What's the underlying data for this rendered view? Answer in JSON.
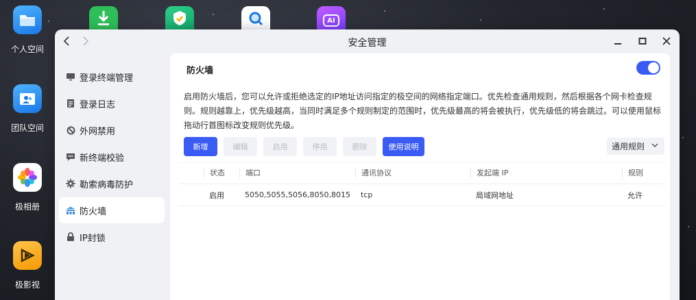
{
  "desktop": {
    "icons": [
      {
        "label": "个人空间",
        "name": "personal-space"
      },
      {
        "label": "团队空间",
        "name": "team-space"
      },
      {
        "label": "极相册",
        "name": "photo-album"
      },
      {
        "label": "极影视",
        "name": "video"
      }
    ],
    "top_apps": [
      {
        "name": "download-app-icon"
      },
      {
        "name": "security-app-icon"
      },
      {
        "name": "search-app-icon"
      },
      {
        "name": "ai-app-icon",
        "text": "AI"
      }
    ]
  },
  "window": {
    "title": "安全管理",
    "sidebar": {
      "items": [
        {
          "label": "登录终端管理",
          "icon": "monitor-icon"
        },
        {
          "label": "登录日志",
          "icon": "document-icon"
        },
        {
          "label": "外网禁用",
          "icon": "ban-icon"
        },
        {
          "label": "新终端校验",
          "icon": "message-icon"
        },
        {
          "label": "勒索病毒防护",
          "icon": "gear-icon"
        },
        {
          "label": "防火墙",
          "icon": "firewall-icon",
          "active": true
        },
        {
          "label": "IP封锁",
          "icon": "lock-icon"
        }
      ]
    },
    "firewall": {
      "title": "防火墙",
      "enabled": true,
      "description": "启用防火墙后，您可以允许或拒绝选定的IP地址访问指定的极空间的网络指定端口。优先检查通用规则，然后根据各个网卡检查规则。规则越靠上，优先级越高，当同时满足多个规则制定的范围时，优先级最高的将会被执行，优先级低的将会跳过。可以使用鼠标拖动行首图标改变规则优先级。",
      "buttons": {
        "add": "新增",
        "edit": "编辑",
        "enable": "启用",
        "disable": "停用",
        "delete": "删除",
        "help": "使用说明"
      },
      "rule_scope": "通用规则",
      "table": {
        "headers": [
          "状态",
          "端口",
          "通讯协议",
          "发起端 IP",
          "规则"
        ],
        "rows": [
          {
            "status": "启用",
            "port": "5050,5055,5056,8050,8015",
            "protocol": "tcp",
            "source_ip": "局域网地址",
            "rule": "允许"
          }
        ]
      }
    }
  },
  "colors": {
    "accent": "#3b5bf5",
    "status_enabled": "#3aab3a"
  }
}
